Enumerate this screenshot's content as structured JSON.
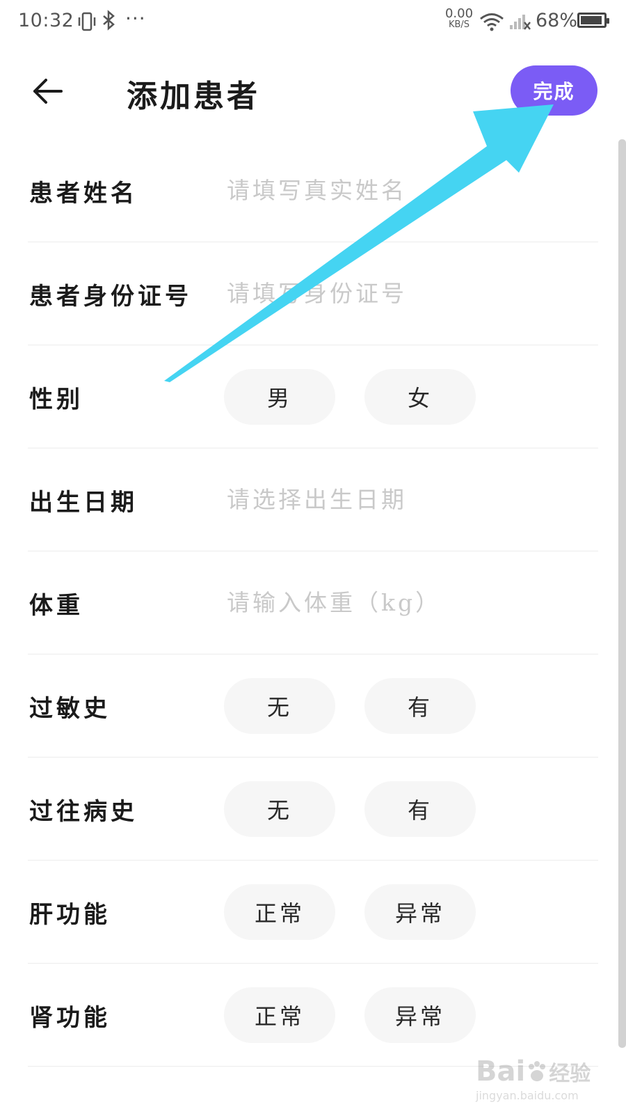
{
  "status_bar": {
    "time": "10:32",
    "more": "···",
    "net_speed_value": "0.00",
    "net_speed_unit": "KB/S",
    "battery_percent": "68%"
  },
  "header": {
    "title": "添加患者",
    "done_label": "完成"
  },
  "form": {
    "name": {
      "label": "患者姓名",
      "placeholder": "请填写真实姓名"
    },
    "id_number": {
      "label": "患者身份证号",
      "placeholder": "请填写身份证号"
    },
    "gender": {
      "label": "性别",
      "options": [
        "男",
        "女"
      ]
    },
    "birth_date": {
      "label": "出生日期",
      "placeholder": "请选择出生日期"
    },
    "weight": {
      "label": "体重",
      "placeholder": "请输入体重（kg）"
    },
    "allergy_history": {
      "label": "过敏史",
      "options": [
        "无",
        "有"
      ]
    },
    "medical_history": {
      "label": "过往病史",
      "options": [
        "无",
        "有"
      ]
    },
    "liver_function": {
      "label": "肝功能",
      "options": [
        "正常",
        "异常"
      ]
    },
    "kidney_function": {
      "label": "肾功能",
      "options": [
        "正常",
        "异常"
      ]
    }
  },
  "colors": {
    "accent": "#7b5cf5",
    "annotation_arrow": "#45d4f2",
    "placeholder": "#c9c9c9",
    "chip_background": "#f6f6f6"
  },
  "watermark": {
    "logo": "Bai",
    "logo_suffix": "经验",
    "url": "jingyan.baidu.com"
  }
}
